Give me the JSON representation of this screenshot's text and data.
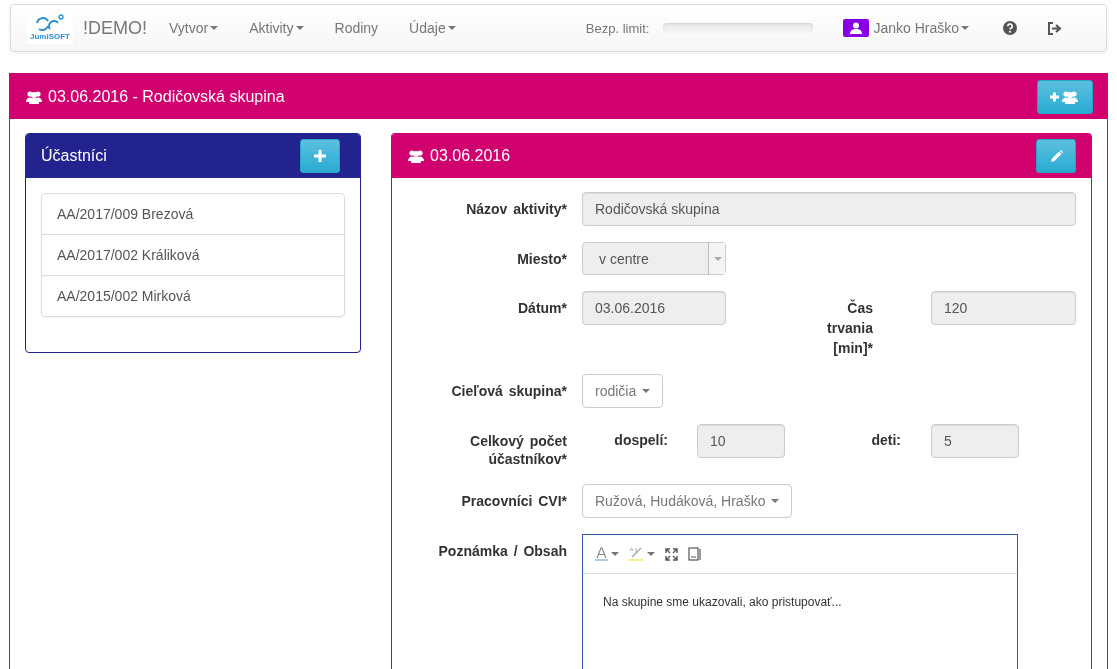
{
  "navbar": {
    "logo_text": "JumiSOFT",
    "brand": "!DEMO!",
    "menu": [
      {
        "label": "Vytvor",
        "dropdown": true
      },
      {
        "label": "Aktivity",
        "dropdown": true
      },
      {
        "label": "Rodiny",
        "dropdown": false
      },
      {
        "label": "Údaje",
        "dropdown": true
      }
    ],
    "limit_label": "Bezp. limit:",
    "limit": {
      "level": 0
    },
    "user": "Janko Hraško"
  },
  "panel": {
    "title": "03.06.2016 - Rodičovská skupina"
  },
  "participants": {
    "title": "Účastníci",
    "items": [
      "AA/2017/009 Brezová",
      "AA/2017/002 Králiková",
      "AA/2015/002 Mirková"
    ]
  },
  "detail": {
    "title": "03.06.2016",
    "rows": [
      {
        "kind": "text",
        "label": "Názov aktivity*",
        "value": "Rodičovská skupina"
      },
      {
        "kind": "select",
        "label": "Miesto*",
        "value": "v centre"
      },
      {
        "kind": "pair",
        "label": "Dátum*",
        "value": "03.06.2016",
        "label2": "Čas trvania [min]*",
        "value2": "120"
      },
      {
        "kind": "dropdown",
        "label": "Cieľová skupina*",
        "value": "rodičia"
      },
      {
        "kind": "counts",
        "label": "Celkový počet účastníkov*",
        "sub1": "dospelí:",
        "value1": "10",
        "sub2": "deti:",
        "value2": "5"
      },
      {
        "kind": "dropdown",
        "label": "Pracovníci CVI*",
        "value": "Ružová, Hudáková, Hraško"
      },
      {
        "kind": "editor",
        "label": "Poznámka / Obsah",
        "value": "Na skupine sme ukazovali, ako pristupovať..."
      }
    ]
  }
}
